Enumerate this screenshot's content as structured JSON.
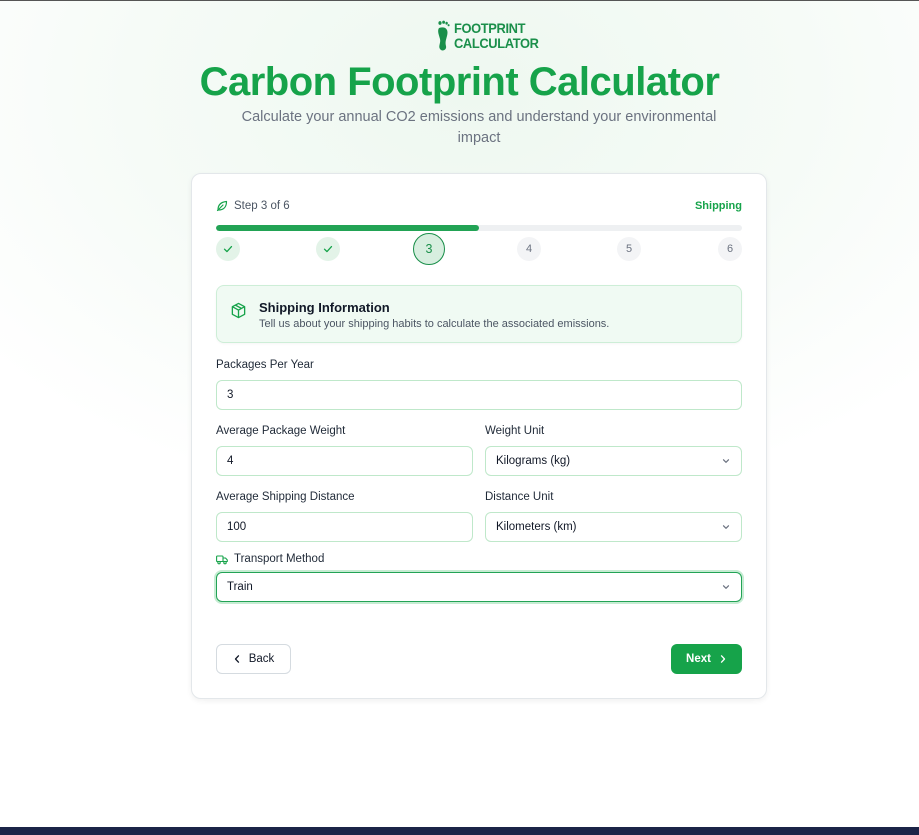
{
  "brand": {
    "logo_line1": "FOOTPRINT",
    "logo_line2": "CALCULATOR",
    "title": "Carbon Footprint Calculator",
    "subtitle": "Calculate your annual CO2 emissions and understand your environmental impact"
  },
  "colors": {
    "accent": "#16a34a",
    "accent_light": "#f0faf3",
    "border_green": "#bfe8ca"
  },
  "progress": {
    "step_label": "Step 3 of 6",
    "section": "Shipping",
    "current_step": 3,
    "total_steps": 6,
    "fill_fraction": 0.5,
    "steps": [
      {
        "label": "",
        "state": "done"
      },
      {
        "label": "",
        "state": "done"
      },
      {
        "label": "3",
        "state": "current"
      },
      {
        "label": "4",
        "state": "upcoming"
      },
      {
        "label": "5",
        "state": "upcoming"
      },
      {
        "label": "6",
        "state": "upcoming"
      }
    ]
  },
  "info": {
    "icon": "package-icon",
    "title": "Shipping Information",
    "description": "Tell us about your shipping habits to calculate the associated emissions."
  },
  "form": {
    "packages_label": "Packages Per Year",
    "packages_value": "3",
    "weight_label": "Average Package Weight",
    "weight_value": "4",
    "weight_unit_label": "Weight Unit",
    "weight_unit_value": "Kilograms (kg)",
    "distance_label": "Average Shipping Distance",
    "distance_value": "100",
    "distance_unit_label": "Distance Unit",
    "distance_unit_value": "Kilometers (km)",
    "transport_label": "Transport Method",
    "transport_value": "Train"
  },
  "nav": {
    "back_label": "Back",
    "next_label": "Next"
  }
}
